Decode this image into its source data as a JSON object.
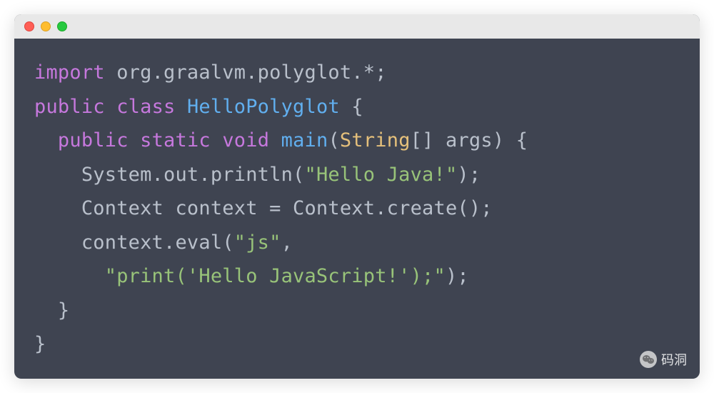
{
  "titlebar": {
    "buttons": {
      "close": "close",
      "minimize": "minimize",
      "zoom": "zoom"
    }
  },
  "syntax_colors": {
    "keyword": "#c678dd",
    "class_name": "#61afef",
    "string": "#98c379",
    "type": "#e5c07b",
    "method": "#61afef",
    "default": "#b9c0cb",
    "background": "#3f4451"
  },
  "code": {
    "tokens": [
      [
        {
          "t": "import",
          "c": "kw"
        },
        {
          "t": " ",
          "c": "punct"
        },
        {
          "t": "org.graalvm.polyglot.*",
          "c": "pkg"
        },
        {
          "t": ";",
          "c": "punct"
        }
      ],
      [
        {
          "t": "public",
          "c": "kw"
        },
        {
          "t": " ",
          "c": "punct"
        },
        {
          "t": "class",
          "c": "kw"
        },
        {
          "t": " ",
          "c": "punct"
        },
        {
          "t": "HelloPolyglot",
          "c": "cls"
        },
        {
          "t": " {",
          "c": "punct"
        }
      ],
      [
        {
          "t": "  ",
          "c": "punct"
        },
        {
          "t": "public",
          "c": "kw"
        },
        {
          "t": " ",
          "c": "punct"
        },
        {
          "t": "static",
          "c": "kw"
        },
        {
          "t": " ",
          "c": "punct"
        },
        {
          "t": "void",
          "c": "kw"
        },
        {
          "t": " ",
          "c": "punct"
        },
        {
          "t": "main",
          "c": "method"
        },
        {
          "t": "(",
          "c": "punct"
        },
        {
          "t": "String",
          "c": "type"
        },
        {
          "t": "[] args) {",
          "c": "punct"
        }
      ],
      [
        {
          "t": "    System.out.println(",
          "c": "ident"
        },
        {
          "t": "\"Hello Java!\"",
          "c": "str"
        },
        {
          "t": ");",
          "c": "punct"
        }
      ],
      [
        {
          "t": "    Context context = Context.create();",
          "c": "ident"
        }
      ],
      [
        {
          "t": "    context.eval(",
          "c": "ident"
        },
        {
          "t": "\"js\"",
          "c": "str"
        },
        {
          "t": ",",
          "c": "punct"
        }
      ],
      [
        {
          "t": "      ",
          "c": "punct"
        },
        {
          "t": "\"print('Hello JavaScript!');\"",
          "c": "str"
        },
        {
          "t": ");",
          "c": "punct"
        }
      ],
      [
        {
          "t": "  }",
          "c": "punct"
        }
      ],
      [
        {
          "t": "}",
          "c": "punct"
        }
      ]
    ]
  },
  "watermark": {
    "text": "码洞",
    "icon": "wechat-icon"
  }
}
